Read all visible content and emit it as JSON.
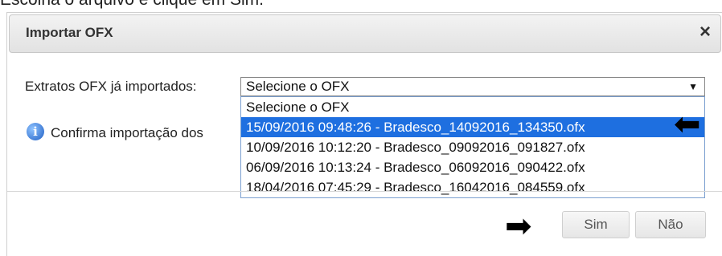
{
  "caption": "Escolha o arquivo e clique em Sim.",
  "dialog": {
    "title": "Importar OFX",
    "close": "×"
  },
  "form": {
    "label": "Extratos OFX já importados:",
    "select_value": "Selecione o OFX",
    "options": [
      "Selecione o OFX",
      "15/09/2016 09:48:26 - Bradesco_14092016_134350.ofx",
      "10/09/2016 10:12:20 - Bradesco_09092016_091827.ofx",
      "06/09/2016 10:13:24 - Bradesco_06092016_090422.ofx",
      "18/04/2016 07:45:29 - Bradesco_16042016_084559.ofx"
    ],
    "highlighted_index": 1
  },
  "confirm": {
    "text": "Confirma importação dos"
  },
  "buttons": {
    "sim": "Sim",
    "nao": "Não"
  },
  "icons": {
    "info": "info-icon",
    "arrow_left": "arrow-left-icon",
    "arrow_right": "arrow-right-icon"
  }
}
